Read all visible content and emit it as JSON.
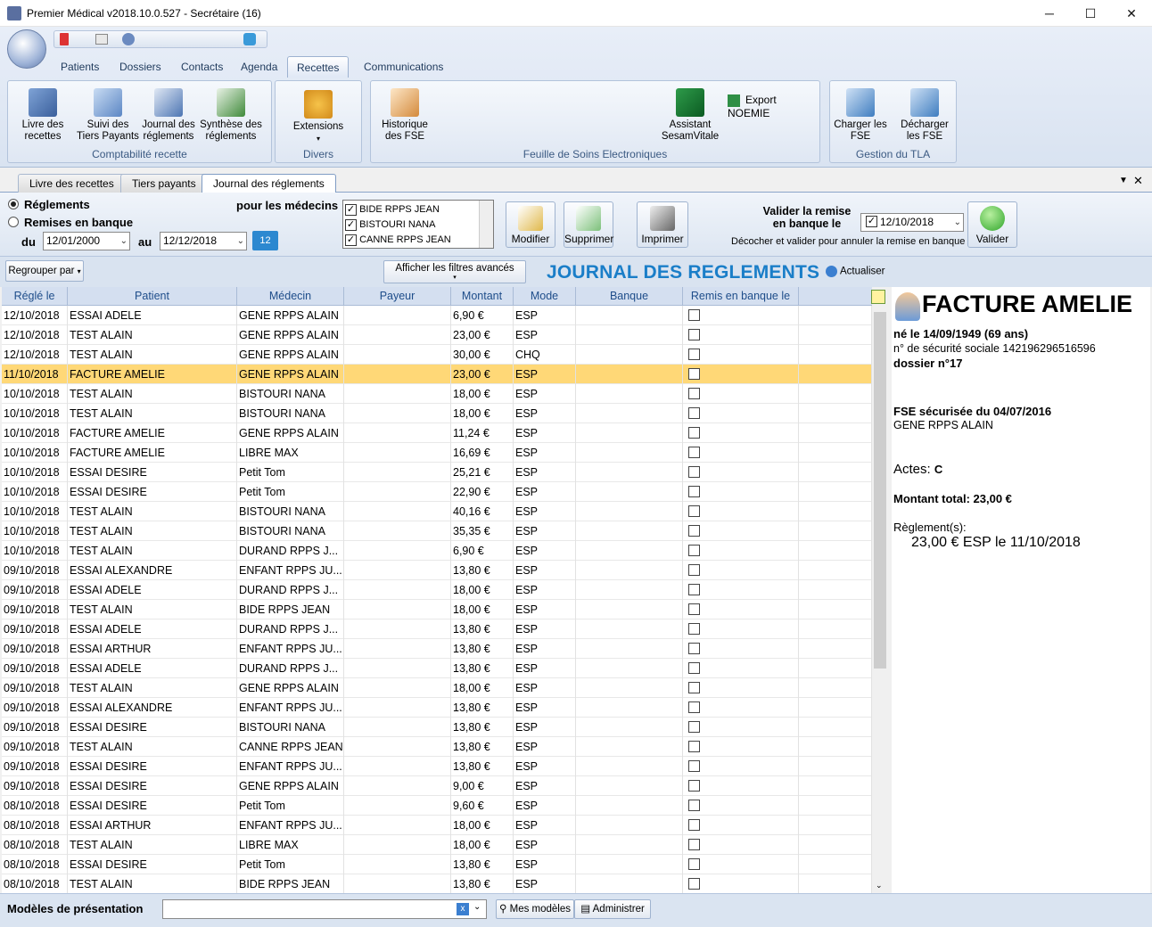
{
  "window": {
    "title": "Premier Médical v2018.10.0.527 - Secrétaire  (16)"
  },
  "ribbon": {
    "tabs": [
      "Patients",
      "Dossiers",
      "Contacts",
      "Agenda",
      "Recettes",
      "Communications"
    ],
    "active_tab": "Recettes",
    "groups": {
      "compta": {
        "label": "Comptabilité recette",
        "buttons": [
          "Livre des\nrecettes",
          "Suivi des\nTiers Payants",
          "Journal des\nréglements",
          "Synthèse des\nréglements"
        ]
      },
      "divers": {
        "label": "Divers",
        "buttons": [
          "Extensions"
        ]
      },
      "fse": {
        "label": "Feuille de Soins Electroniques",
        "buttons": [
          "Historique\ndes FSE",
          "Assistant\nSesamVitale"
        ],
        "export": "Export NOEMIE"
      },
      "tla": {
        "label": "Gestion du TLA",
        "buttons": [
          "Charger les\nFSE",
          "Décharger\nles FSE"
        ]
      }
    }
  },
  "doc_tabs": [
    "Livre des recettes",
    "Tiers payants",
    "Journal des réglements"
  ],
  "filters": {
    "reglements": "Réglements",
    "remises": "Remises en banque",
    "du_label": "du",
    "du_value": "12/01/2000",
    "au_label": "au",
    "au_value": "12/12/2018",
    "medecins_label": "pour les médecins",
    "medecins": [
      "BIDE RPPS JEAN",
      "BISTOURI NANA",
      "CANNE RPPS JEAN"
    ],
    "modifier": "Modifier",
    "supprimer": "Supprimer",
    "imprimer": "Imprimer",
    "valider_remise": "Valider la remise\nen banque le",
    "remise_date": "12/10/2018",
    "decocher": "Décocher et valider pour annuler la remise en banque",
    "valider": "Valider"
  },
  "toolbar": {
    "regrouper": "Regrouper par",
    "filtres": "Afficher les filtres avancés",
    "title": "JOURNAL DES REGLEMENTS",
    "actualiser": "Actualiser"
  },
  "grid": {
    "columns": [
      "Réglé le",
      "Patient",
      "Médecin",
      "Payeur",
      "Montant",
      "Mode",
      "Banque",
      "Remis en banque le"
    ],
    "rows": [
      [
        "12/10/2018",
        "ESSAI ADELE",
        "GENE RPPS ALAIN",
        "",
        "6,90 €",
        "ESP"
      ],
      [
        "12/10/2018",
        "TEST ALAIN",
        "GENE RPPS ALAIN",
        "",
        "23,00 €",
        "ESP"
      ],
      [
        "12/10/2018",
        "TEST ALAIN",
        "GENE RPPS ALAIN",
        "",
        "30,00 €",
        "CHQ"
      ],
      [
        "11/10/2018",
        "FACTURE AMELIE",
        "GENE RPPS ALAIN",
        "",
        "23,00 €",
        "ESP"
      ],
      [
        "10/10/2018",
        "TEST ALAIN",
        "BISTOURI NANA",
        "",
        "18,00 €",
        "ESP"
      ],
      [
        "10/10/2018",
        "TEST ALAIN",
        "BISTOURI NANA",
        "",
        "18,00 €",
        "ESP"
      ],
      [
        "10/10/2018",
        "FACTURE AMELIE",
        "GENE RPPS ALAIN",
        "",
        "11,24 €",
        "ESP"
      ],
      [
        "10/10/2018",
        "FACTURE AMELIE",
        "LIBRE MAX",
        "",
        "16,69 €",
        "ESP"
      ],
      [
        "10/10/2018",
        "ESSAI DESIRE",
        "Petit Tom",
        "",
        "25,21 €",
        "ESP"
      ],
      [
        "10/10/2018",
        "ESSAI DESIRE",
        "Petit Tom",
        "",
        "22,90 €",
        "ESP"
      ],
      [
        "10/10/2018",
        "TEST ALAIN",
        "BISTOURI NANA",
        "",
        "40,16 €",
        "ESP"
      ],
      [
        "10/10/2018",
        "TEST ALAIN",
        "BISTOURI NANA",
        "",
        "35,35 €",
        "ESP"
      ],
      [
        "10/10/2018",
        "TEST ALAIN",
        "DURAND  RPPS  J...",
        "",
        "6,90 €",
        "ESP"
      ],
      [
        "09/10/2018",
        "ESSAI ALEXANDRE",
        "ENFANT  RPPS  JU...",
        "",
        "13,80 €",
        "ESP"
      ],
      [
        "09/10/2018",
        "ESSAI ADELE",
        "DURAND  RPPS  J...",
        "",
        "18,00 €",
        "ESP"
      ],
      [
        "09/10/2018",
        "TEST ALAIN",
        "BIDE RPPS JEAN",
        "",
        "18,00 €",
        "ESP"
      ],
      [
        "09/10/2018",
        "ESSAI ADELE",
        "DURAND  RPPS  J...",
        "",
        "13,80 €",
        "ESP"
      ],
      [
        "09/10/2018",
        "ESSAI ARTHUR",
        "ENFANT  RPPS  JU...",
        "",
        "13,80 €",
        "ESP"
      ],
      [
        "09/10/2018",
        "ESSAI ADELE",
        "DURAND  RPPS  J...",
        "",
        "13,80 €",
        "ESP"
      ],
      [
        "09/10/2018",
        "TEST ALAIN",
        "GENE RPPS ALAIN",
        "",
        "18,00 €",
        "ESP"
      ],
      [
        "09/10/2018",
        "ESSAI ALEXANDRE",
        "ENFANT  RPPS  JU...",
        "",
        "13,80 €",
        "ESP"
      ],
      [
        "09/10/2018",
        "ESSAI DESIRE",
        "BISTOURI NANA",
        "",
        "13,80 €",
        "ESP"
      ],
      [
        "09/10/2018",
        "TEST ALAIN",
        "CANNE RPPS JEAN",
        "",
        "13,80 €",
        "ESP"
      ],
      [
        "09/10/2018",
        "ESSAI DESIRE",
        "ENFANT  RPPS  JU...",
        "",
        "13,80 €",
        "ESP"
      ],
      [
        "09/10/2018",
        "ESSAI DESIRE",
        "GENE RPPS ALAIN",
        "",
        "9,00 €",
        "ESP"
      ],
      [
        "08/10/2018",
        "ESSAI DESIRE",
        "Petit Tom",
        "",
        "9,60 €",
        "ESP"
      ],
      [
        "08/10/2018",
        "ESSAI ARTHUR",
        "ENFANT  RPPS  JU...",
        "",
        "18,00 €",
        "ESP"
      ],
      [
        "08/10/2018",
        "TEST ALAIN",
        "LIBRE MAX",
        "",
        "18,00 €",
        "ESP"
      ],
      [
        "08/10/2018",
        "ESSAI DESIRE",
        "Petit Tom",
        "",
        "13,80 €",
        "ESP"
      ],
      [
        "08/10/2018",
        "TEST ALAIN",
        "BIDE RPPS JEAN",
        "",
        "13,80 €",
        "ESP"
      ]
    ],
    "selected_index": 3
  },
  "detail": {
    "name": "FACTURE AMELIE",
    "birth": "né le 14/09/1949 (69 ans)",
    "ssn": "n° de sécurité sociale 142196296516596",
    "dossier": "dossier n°17",
    "fse": "FSE sécurisée du 04/07/2016",
    "medecin": "GENE RPPS ALAIN",
    "actes_label": "Actes:",
    "actes_value": "C",
    "montant": "Montant total: 23,00 €",
    "reglements_label": "Règlement(s):",
    "reglement_line": "23,00 € ESP le 11/10/2018"
  },
  "bottom": {
    "modeles": "Modèles de présentation",
    "mes_modeles": "Mes modèles",
    "administrer": "Administrer",
    "clear": "x"
  }
}
